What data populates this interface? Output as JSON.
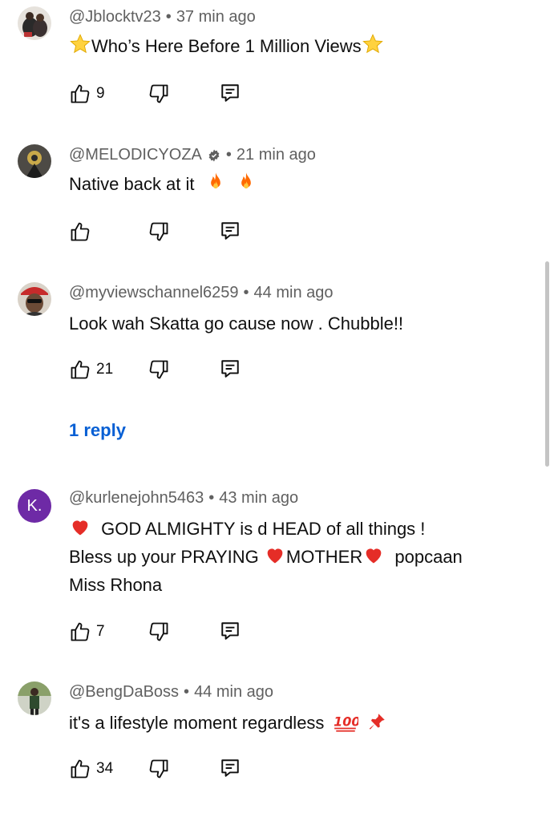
{
  "comments": [
    {
      "handle": "@Jblocktv23",
      "time": "37 min ago",
      "text": "Who’s Here Before 1 Million Views",
      "likes": "9",
      "verified": false,
      "avatar_icon": "user-photo-avatar"
    },
    {
      "handle": "@MELODICYOZA",
      "time": "21 min ago",
      "text": "Native back at it",
      "likes": "",
      "verified": true,
      "avatar_icon": "user-photo-avatar"
    },
    {
      "handle": "@myviewschannel6259",
      "time": "44 min ago",
      "text": "Look wah Skatta go cause now . Chubble!!",
      "likes": "21",
      "verified": false,
      "avatar_icon": "user-photo-avatar"
    },
    {
      "handle": "@kurlenejohn5463",
      "time": "43 min ago",
      "text_line1": "GOD ALMIGHTY is d HEAD of all things !",
      "text_line2a": "Bless up your PRAYING",
      "text_line2b": "MOTHER",
      "text_line2c": "popcaan",
      "text_line3": "Miss Rhona",
      "likes": "7",
      "verified": false,
      "avatar_letter": "K."
    },
    {
      "handle": "@BengDaBoss",
      "time": "44 min ago",
      "text": "it's a lifestyle moment regardless",
      "likes": "34",
      "verified": false,
      "avatar_icon": "user-photo-avatar"
    }
  ],
  "reply_link": "1 reply",
  "colors": {
    "link": "#065fd4",
    "meta": "#606060",
    "avatar_k": "#6e2aa6"
  }
}
